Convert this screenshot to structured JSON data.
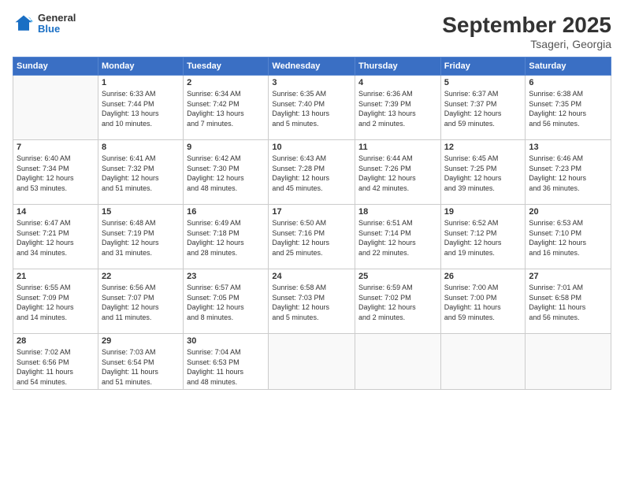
{
  "header": {
    "logo": {
      "general": "General",
      "blue": "Blue"
    },
    "title": "September 2025",
    "subtitle": "Tsageri, Georgia"
  },
  "weekdays": [
    "Sunday",
    "Monday",
    "Tuesday",
    "Wednesday",
    "Thursday",
    "Friday",
    "Saturday"
  ],
  "weeks": [
    [
      {
        "day": "",
        "detail": ""
      },
      {
        "day": "1",
        "detail": "Sunrise: 6:33 AM\nSunset: 7:44 PM\nDaylight: 13 hours\nand 10 minutes."
      },
      {
        "day": "2",
        "detail": "Sunrise: 6:34 AM\nSunset: 7:42 PM\nDaylight: 13 hours\nand 7 minutes."
      },
      {
        "day": "3",
        "detail": "Sunrise: 6:35 AM\nSunset: 7:40 PM\nDaylight: 13 hours\nand 5 minutes."
      },
      {
        "day": "4",
        "detail": "Sunrise: 6:36 AM\nSunset: 7:39 PM\nDaylight: 13 hours\nand 2 minutes."
      },
      {
        "day": "5",
        "detail": "Sunrise: 6:37 AM\nSunset: 7:37 PM\nDaylight: 12 hours\nand 59 minutes."
      },
      {
        "day": "6",
        "detail": "Sunrise: 6:38 AM\nSunset: 7:35 PM\nDaylight: 12 hours\nand 56 minutes."
      }
    ],
    [
      {
        "day": "7",
        "detail": "Sunrise: 6:40 AM\nSunset: 7:34 PM\nDaylight: 12 hours\nand 53 minutes."
      },
      {
        "day": "8",
        "detail": "Sunrise: 6:41 AM\nSunset: 7:32 PM\nDaylight: 12 hours\nand 51 minutes."
      },
      {
        "day": "9",
        "detail": "Sunrise: 6:42 AM\nSunset: 7:30 PM\nDaylight: 12 hours\nand 48 minutes."
      },
      {
        "day": "10",
        "detail": "Sunrise: 6:43 AM\nSunset: 7:28 PM\nDaylight: 12 hours\nand 45 minutes."
      },
      {
        "day": "11",
        "detail": "Sunrise: 6:44 AM\nSunset: 7:26 PM\nDaylight: 12 hours\nand 42 minutes."
      },
      {
        "day": "12",
        "detail": "Sunrise: 6:45 AM\nSunset: 7:25 PM\nDaylight: 12 hours\nand 39 minutes."
      },
      {
        "day": "13",
        "detail": "Sunrise: 6:46 AM\nSunset: 7:23 PM\nDaylight: 12 hours\nand 36 minutes."
      }
    ],
    [
      {
        "day": "14",
        "detail": "Sunrise: 6:47 AM\nSunset: 7:21 PM\nDaylight: 12 hours\nand 34 minutes."
      },
      {
        "day": "15",
        "detail": "Sunrise: 6:48 AM\nSunset: 7:19 PM\nDaylight: 12 hours\nand 31 minutes."
      },
      {
        "day": "16",
        "detail": "Sunrise: 6:49 AM\nSunset: 7:18 PM\nDaylight: 12 hours\nand 28 minutes."
      },
      {
        "day": "17",
        "detail": "Sunrise: 6:50 AM\nSunset: 7:16 PM\nDaylight: 12 hours\nand 25 minutes."
      },
      {
        "day": "18",
        "detail": "Sunrise: 6:51 AM\nSunset: 7:14 PM\nDaylight: 12 hours\nand 22 minutes."
      },
      {
        "day": "19",
        "detail": "Sunrise: 6:52 AM\nSunset: 7:12 PM\nDaylight: 12 hours\nand 19 minutes."
      },
      {
        "day": "20",
        "detail": "Sunrise: 6:53 AM\nSunset: 7:10 PM\nDaylight: 12 hours\nand 16 minutes."
      }
    ],
    [
      {
        "day": "21",
        "detail": "Sunrise: 6:55 AM\nSunset: 7:09 PM\nDaylight: 12 hours\nand 14 minutes."
      },
      {
        "day": "22",
        "detail": "Sunrise: 6:56 AM\nSunset: 7:07 PM\nDaylight: 12 hours\nand 11 minutes."
      },
      {
        "day": "23",
        "detail": "Sunrise: 6:57 AM\nSunset: 7:05 PM\nDaylight: 12 hours\nand 8 minutes."
      },
      {
        "day": "24",
        "detail": "Sunrise: 6:58 AM\nSunset: 7:03 PM\nDaylight: 12 hours\nand 5 minutes."
      },
      {
        "day": "25",
        "detail": "Sunrise: 6:59 AM\nSunset: 7:02 PM\nDaylight: 12 hours\nand 2 minutes."
      },
      {
        "day": "26",
        "detail": "Sunrise: 7:00 AM\nSunset: 7:00 PM\nDaylight: 11 hours\nand 59 minutes."
      },
      {
        "day": "27",
        "detail": "Sunrise: 7:01 AM\nSunset: 6:58 PM\nDaylight: 11 hours\nand 56 minutes."
      }
    ],
    [
      {
        "day": "28",
        "detail": "Sunrise: 7:02 AM\nSunset: 6:56 PM\nDaylight: 11 hours\nand 54 minutes."
      },
      {
        "day": "29",
        "detail": "Sunrise: 7:03 AM\nSunset: 6:54 PM\nDaylight: 11 hours\nand 51 minutes."
      },
      {
        "day": "30",
        "detail": "Sunrise: 7:04 AM\nSunset: 6:53 PM\nDaylight: 11 hours\nand 48 minutes."
      },
      {
        "day": "",
        "detail": ""
      },
      {
        "day": "",
        "detail": ""
      },
      {
        "day": "",
        "detail": ""
      },
      {
        "day": "",
        "detail": ""
      }
    ]
  ]
}
